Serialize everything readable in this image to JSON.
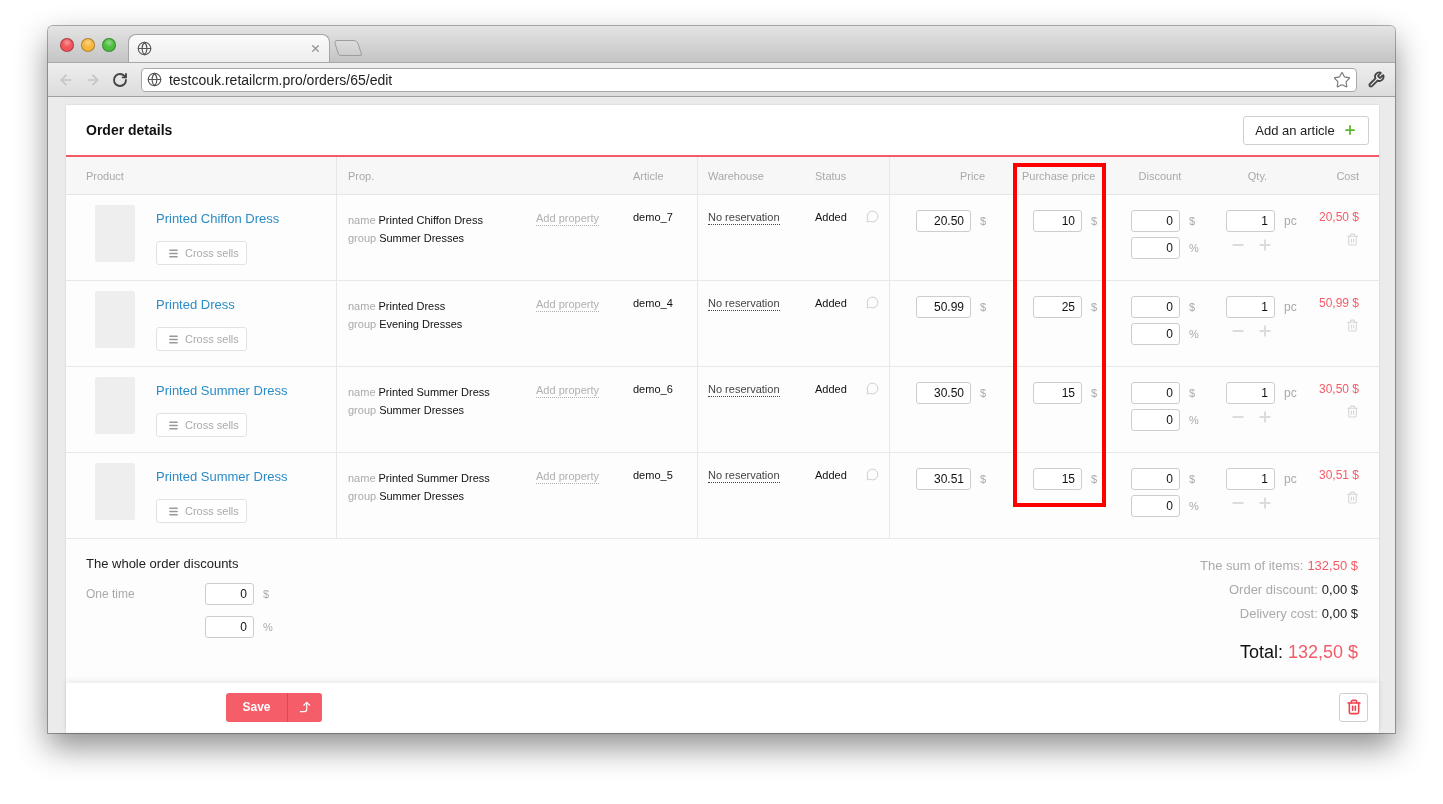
{
  "browser": {
    "url": "testcouk.retailcrm.pro/orders/65/edit"
  },
  "order": {
    "title": "Order details",
    "add_button": "Add an article"
  },
  "table": {
    "columns": [
      {
        "label": "Product",
        "highlighted": false
      },
      {
        "label": "Prop.",
        "highlighted": false
      },
      {
        "label": "Article",
        "highlighted": false
      },
      {
        "label": "Warehouse",
        "highlighted": false
      },
      {
        "label": "Status",
        "highlighted": false
      },
      {
        "label": "Price",
        "highlighted": false
      },
      {
        "label": "Purchase price",
        "highlighted": true
      },
      {
        "label": "Discount",
        "highlighted": false
      },
      {
        "label": "Qty.",
        "highlighted": false
      },
      {
        "label": "Cost",
        "highlighted": false
      }
    ],
    "rows": [
      {
        "product": "Printed Chiffon Dress",
        "cross_sells": "Cross sells",
        "props": [
          {
            "key": "name",
            "value": "Printed Chiffon Dress"
          },
          {
            "key": "group",
            "value": "Summer Dresses"
          }
        ],
        "add_property": "Add property",
        "article": "demo_7",
        "warehouse": "No reservation",
        "status": "Added",
        "price": "20.50",
        "price_currency": "$",
        "purchase_price": "10",
        "purchase_currency": "$",
        "discount": "0",
        "discount_currency": "$",
        "discount_percent": "0",
        "percent_sign": "%",
        "qty": "1",
        "unit": "pc",
        "cost": "20,50 $"
      },
      {
        "product": "Printed Dress",
        "cross_sells": "Cross sells",
        "props": [
          {
            "key": "name",
            "value": "Printed Dress"
          },
          {
            "key": "group",
            "value": "Evening Dresses"
          }
        ],
        "add_property": "Add property",
        "article": "demo_4",
        "warehouse": "No reservation",
        "status": "Added",
        "price": "50.99",
        "price_currency": "$",
        "purchase_price": "25",
        "purchase_currency": "$",
        "discount": "0",
        "discount_currency": "$",
        "discount_percent": "0",
        "percent_sign": "%",
        "qty": "1",
        "unit": "pc",
        "cost": "50,99 $"
      },
      {
        "product": "Printed Summer Dress",
        "cross_sells": "Cross sells",
        "props": [
          {
            "key": "name",
            "value": "Printed Summer Dress"
          },
          {
            "key": "group",
            "value": "Summer Dresses"
          }
        ],
        "add_property": "Add property",
        "article": "demo_6",
        "warehouse": "No reservation",
        "status": "Added",
        "price": "30.50",
        "price_currency": "$",
        "purchase_price": "15",
        "purchase_currency": "$",
        "discount": "0",
        "discount_currency": "$",
        "discount_percent": "0",
        "percent_sign": "%",
        "qty": "1",
        "unit": "pc",
        "cost": "30,50 $"
      },
      {
        "product": "Printed Summer Dress",
        "cross_sells": "Cross sells",
        "props": [
          {
            "key": "name",
            "value": "Printed Summer Dress"
          },
          {
            "key": "group",
            "value": "Summer Dresses"
          }
        ],
        "add_property": "Add property",
        "article": "demo_5",
        "warehouse": "No reservation",
        "status": "Added",
        "price": "30.51",
        "price_currency": "$",
        "purchase_price": "15",
        "purchase_currency": "$",
        "discount": "0",
        "discount_currency": "$",
        "discount_percent": "0",
        "percent_sign": "%",
        "qty": "1",
        "unit": "pc",
        "cost": "30,51 $"
      }
    ]
  },
  "order_discounts": {
    "title": "The whole order discounts",
    "label": "One time",
    "amount": "0",
    "currency": "$",
    "percent": "0",
    "percent_sign": "%"
  },
  "totals": [
    {
      "label": "The sum of items:",
      "value": "132,50 $",
      "kind": "accent"
    },
    {
      "label": "Order discount:",
      "value": "0,00 $",
      "kind": "plain"
    },
    {
      "label": "Delivery cost:",
      "value": "0,00 $",
      "kind": "plain"
    }
  ],
  "total": {
    "label": "Total:",
    "value": "132,50 $"
  },
  "footer": {
    "save": "Save"
  }
}
